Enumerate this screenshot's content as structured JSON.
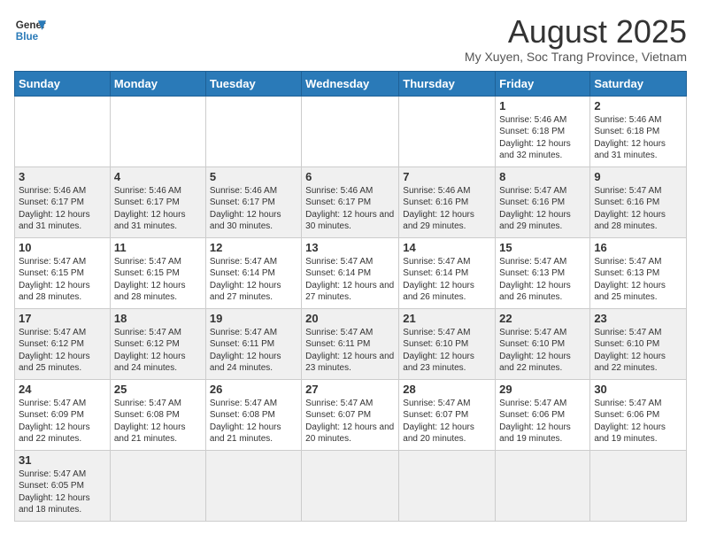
{
  "logo": {
    "line1": "General",
    "line2": "Blue"
  },
  "calendar": {
    "title": "August 2025",
    "subtitle": "My Xuyen, Soc Trang Province, Vietnam",
    "days_of_week": [
      "Sunday",
      "Monday",
      "Tuesday",
      "Wednesday",
      "Thursday",
      "Friday",
      "Saturday"
    ],
    "weeks": [
      [
        {
          "day": "",
          "info": ""
        },
        {
          "day": "",
          "info": ""
        },
        {
          "day": "",
          "info": ""
        },
        {
          "day": "",
          "info": ""
        },
        {
          "day": "",
          "info": ""
        },
        {
          "day": "1",
          "info": "Sunrise: 5:46 AM\nSunset: 6:18 PM\nDaylight: 12 hours and 32 minutes."
        },
        {
          "day": "2",
          "info": "Sunrise: 5:46 AM\nSunset: 6:18 PM\nDaylight: 12 hours and 31 minutes."
        }
      ],
      [
        {
          "day": "3",
          "info": "Sunrise: 5:46 AM\nSunset: 6:17 PM\nDaylight: 12 hours and 31 minutes."
        },
        {
          "day": "4",
          "info": "Sunrise: 5:46 AM\nSunset: 6:17 PM\nDaylight: 12 hours and 31 minutes."
        },
        {
          "day": "5",
          "info": "Sunrise: 5:46 AM\nSunset: 6:17 PM\nDaylight: 12 hours and 30 minutes."
        },
        {
          "day": "6",
          "info": "Sunrise: 5:46 AM\nSunset: 6:17 PM\nDaylight: 12 hours and 30 minutes."
        },
        {
          "day": "7",
          "info": "Sunrise: 5:46 AM\nSunset: 6:16 PM\nDaylight: 12 hours and 29 minutes."
        },
        {
          "day": "8",
          "info": "Sunrise: 5:47 AM\nSunset: 6:16 PM\nDaylight: 12 hours and 29 minutes."
        },
        {
          "day": "9",
          "info": "Sunrise: 5:47 AM\nSunset: 6:16 PM\nDaylight: 12 hours and 28 minutes."
        }
      ],
      [
        {
          "day": "10",
          "info": "Sunrise: 5:47 AM\nSunset: 6:15 PM\nDaylight: 12 hours and 28 minutes."
        },
        {
          "day": "11",
          "info": "Sunrise: 5:47 AM\nSunset: 6:15 PM\nDaylight: 12 hours and 28 minutes."
        },
        {
          "day": "12",
          "info": "Sunrise: 5:47 AM\nSunset: 6:14 PM\nDaylight: 12 hours and 27 minutes."
        },
        {
          "day": "13",
          "info": "Sunrise: 5:47 AM\nSunset: 6:14 PM\nDaylight: 12 hours and 27 minutes."
        },
        {
          "day": "14",
          "info": "Sunrise: 5:47 AM\nSunset: 6:14 PM\nDaylight: 12 hours and 26 minutes."
        },
        {
          "day": "15",
          "info": "Sunrise: 5:47 AM\nSunset: 6:13 PM\nDaylight: 12 hours and 26 minutes."
        },
        {
          "day": "16",
          "info": "Sunrise: 5:47 AM\nSunset: 6:13 PM\nDaylight: 12 hours and 25 minutes."
        }
      ],
      [
        {
          "day": "17",
          "info": "Sunrise: 5:47 AM\nSunset: 6:12 PM\nDaylight: 12 hours and 25 minutes."
        },
        {
          "day": "18",
          "info": "Sunrise: 5:47 AM\nSunset: 6:12 PM\nDaylight: 12 hours and 24 minutes."
        },
        {
          "day": "19",
          "info": "Sunrise: 5:47 AM\nSunset: 6:11 PM\nDaylight: 12 hours and 24 minutes."
        },
        {
          "day": "20",
          "info": "Sunrise: 5:47 AM\nSunset: 6:11 PM\nDaylight: 12 hours and 23 minutes."
        },
        {
          "day": "21",
          "info": "Sunrise: 5:47 AM\nSunset: 6:10 PM\nDaylight: 12 hours and 23 minutes."
        },
        {
          "day": "22",
          "info": "Sunrise: 5:47 AM\nSunset: 6:10 PM\nDaylight: 12 hours and 22 minutes."
        },
        {
          "day": "23",
          "info": "Sunrise: 5:47 AM\nSunset: 6:10 PM\nDaylight: 12 hours and 22 minutes."
        }
      ],
      [
        {
          "day": "24",
          "info": "Sunrise: 5:47 AM\nSunset: 6:09 PM\nDaylight: 12 hours and 22 minutes."
        },
        {
          "day": "25",
          "info": "Sunrise: 5:47 AM\nSunset: 6:08 PM\nDaylight: 12 hours and 21 minutes."
        },
        {
          "day": "26",
          "info": "Sunrise: 5:47 AM\nSunset: 6:08 PM\nDaylight: 12 hours and 21 minutes."
        },
        {
          "day": "27",
          "info": "Sunrise: 5:47 AM\nSunset: 6:07 PM\nDaylight: 12 hours and 20 minutes."
        },
        {
          "day": "28",
          "info": "Sunrise: 5:47 AM\nSunset: 6:07 PM\nDaylight: 12 hours and 20 minutes."
        },
        {
          "day": "29",
          "info": "Sunrise: 5:47 AM\nSunset: 6:06 PM\nDaylight: 12 hours and 19 minutes."
        },
        {
          "day": "30",
          "info": "Sunrise: 5:47 AM\nSunset: 6:06 PM\nDaylight: 12 hours and 19 minutes."
        }
      ],
      [
        {
          "day": "31",
          "info": "Sunrise: 5:47 AM\nSunset: 6:05 PM\nDaylight: 12 hours and 18 minutes."
        },
        {
          "day": "",
          "info": ""
        },
        {
          "day": "",
          "info": ""
        },
        {
          "day": "",
          "info": ""
        },
        {
          "day": "",
          "info": ""
        },
        {
          "day": "",
          "info": ""
        },
        {
          "day": "",
          "info": ""
        }
      ]
    ]
  }
}
